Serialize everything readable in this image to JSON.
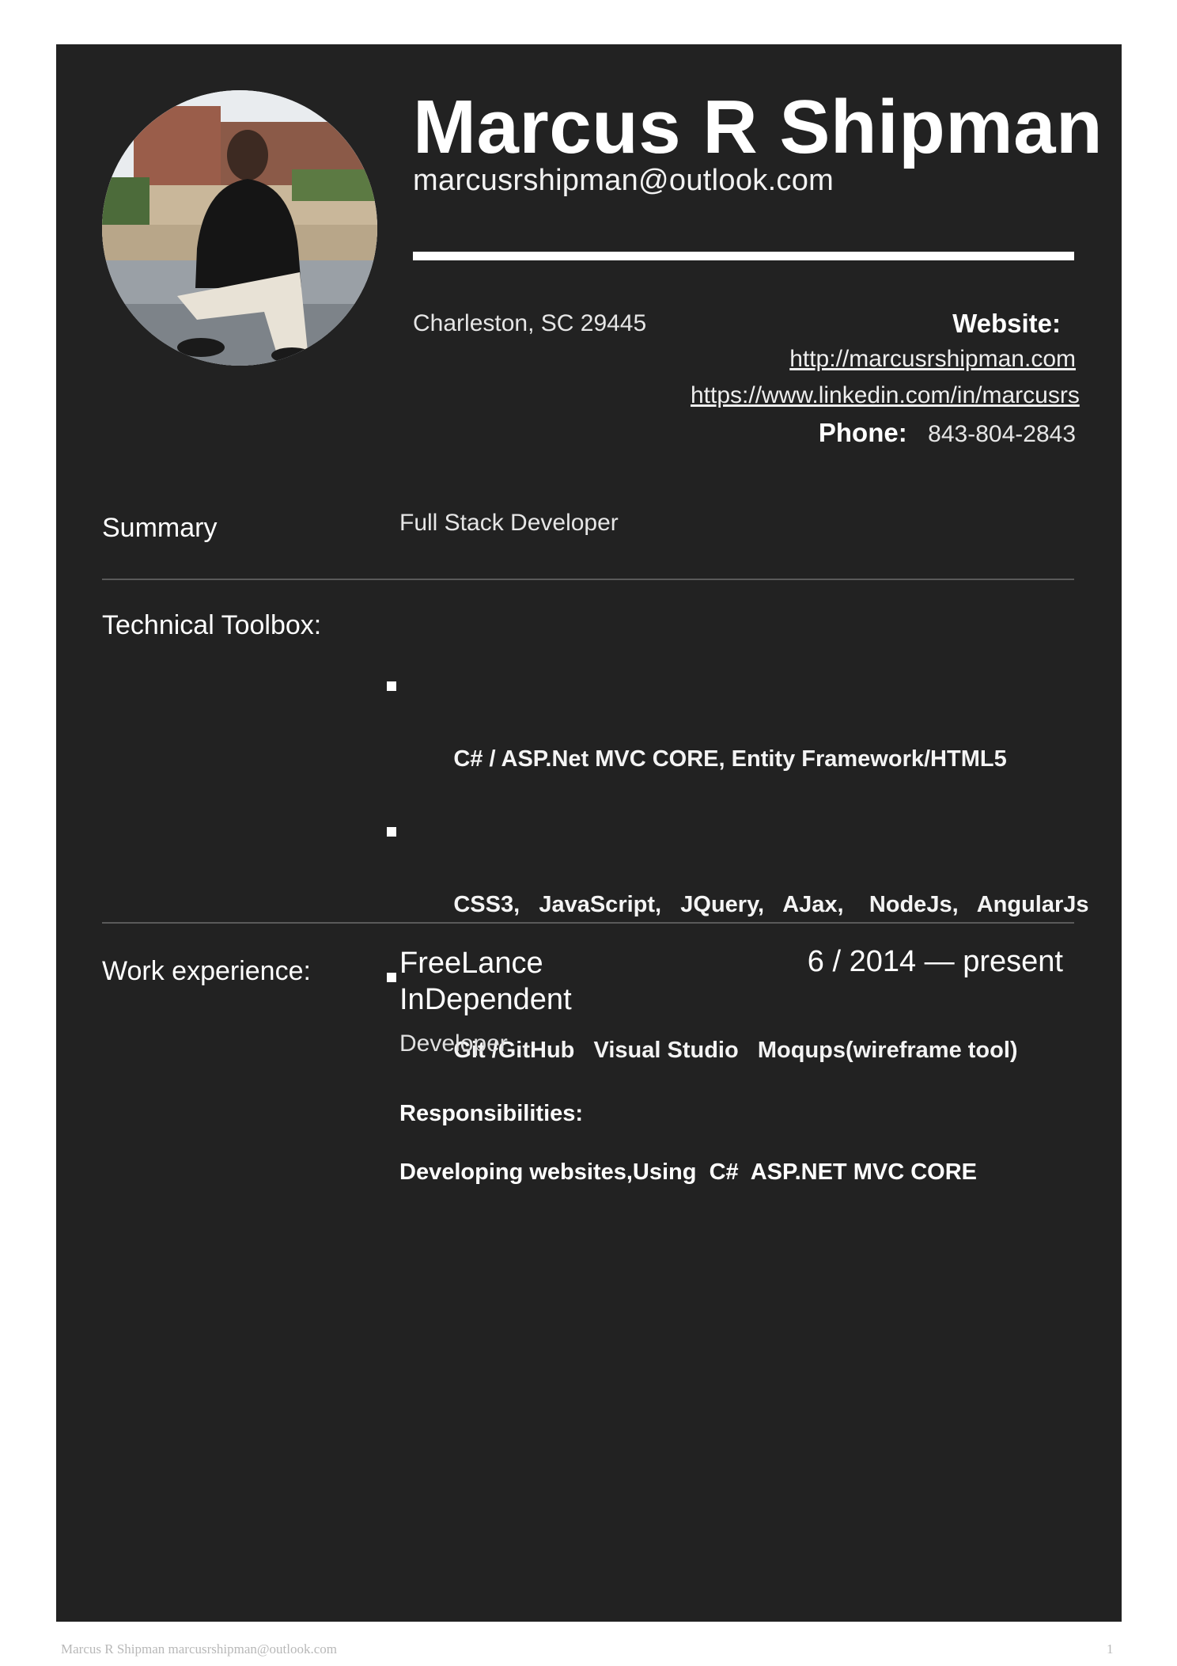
{
  "header": {
    "name": "Marcus R Shipman",
    "email": "marcusrshipman@outlook.com",
    "location": "Charleston, SC 29445",
    "website_label": "Website:",
    "links": [
      "http://marcusrshipman.com",
      "https://www.linkedin.com/in/marcusrs"
    ],
    "phone_label": "Phone:",
    "phone": "843-804-2843"
  },
  "summary": {
    "label": "Summary",
    "text": "Full Stack Developer"
  },
  "toolbox": {
    "label": "Technical Toolbox:",
    "items": [
      "C# / ASP.Net MVC CORE, Entity Framework/HTML5",
      "CSS3,   JavaScript,   JQuery,   AJax,    NodeJs,   AngularJs",
      "Git /GitHub   Visual Studio   Moqups(wireframe tool)"
    ]
  },
  "work": {
    "label": "Work experience:",
    "company": "FreeLance InDependent",
    "dates": "6 / 2014 — present",
    "role": "Developer",
    "responsibilities_label": "Responsibilities:",
    "responsibilities_text": "Developing websites,Using  C#  ASP.NET MVC CORE"
  },
  "footer": {
    "left": "Marcus R Shipman marcusrshipman@outlook.com",
    "page": "1"
  },
  "colors": {
    "panel": "#222222",
    "text": "#ffffff",
    "page_background": "#ffffff"
  },
  "icons": [
    "list-bullet-icon"
  ]
}
